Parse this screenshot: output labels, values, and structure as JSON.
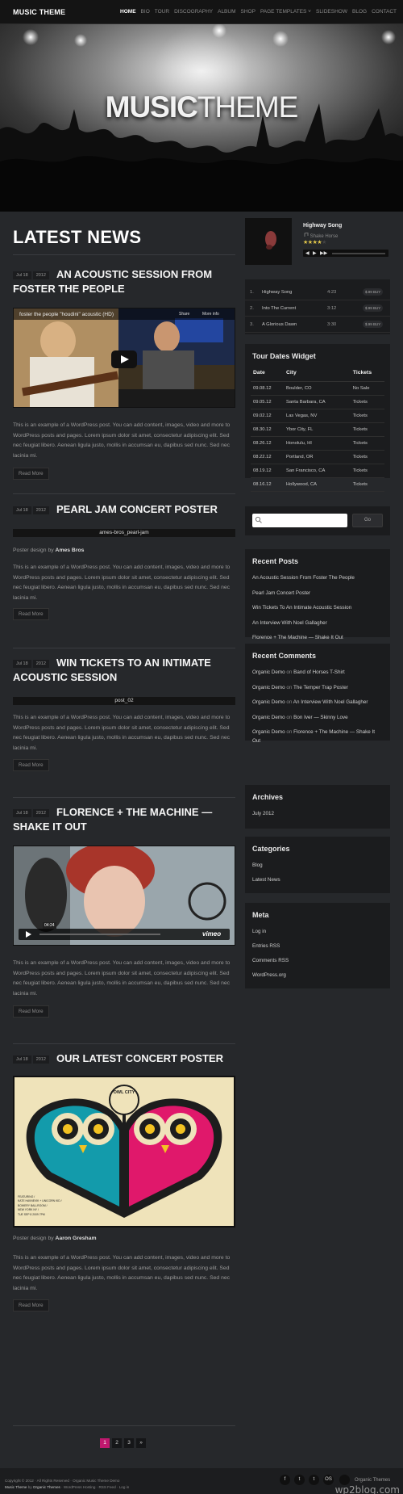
{
  "header": {
    "logo": "MUSIC THEME",
    "nav": [
      "HOME",
      "BIO",
      "TOUR",
      "DISCOGRAPHY",
      "ALBUM",
      "SHOP",
      "PAGE TEMPLATES ˅",
      "SLIDESHOW",
      "BLOG",
      "CONTACT"
    ],
    "active": "HOME"
  },
  "hero": {
    "title_bold": "MUSIC",
    "title_light": "THEME"
  },
  "main": {
    "heading": "LATEST NEWS",
    "read_more": "Read More",
    "excerpt": "This is an example of a WordPress post. You can add content, images, video and more to WordPress posts and pages. Lorem ipsum dolor sit amet, consectetur adipiscing elit. Sed nec feugiat libero. Aenean ligula justo, mollis in accumsan eu, dapibus sed nunc. Sed nec lacinia mi.",
    "posts": [
      {
        "month": "Jul 18",
        "year": "2012",
        "title": "AN ACOUSTIC SESSION FROM FOSTER THE PEOPLE",
        "video_title": "foster the people \"houdini\" acoustic (HD)",
        "share": "Share",
        "more_info": "More info"
      },
      {
        "month": "Jul 18",
        "year": "2012",
        "title": "PEARL JAM CONCERT POSTER",
        "caption": "ames-bros_pearl-jam",
        "poster_by_label": "Poster design by",
        "poster_by": "Ames Bros"
      },
      {
        "month": "Jul 18",
        "year": "2012",
        "title": "WIN TICKETS TO AN INTIMATE ACOUSTIC SESSION",
        "caption": "post_02"
      },
      {
        "month": "Jul 18",
        "year": "2012",
        "title": "FLORENCE + THE MACHINE — SHAKE IT OUT",
        "video_time": "04:24",
        "video_brand": "vimeo"
      },
      {
        "month": "Jul 18",
        "year": "2012",
        "title": "OUR LATEST CONCERT POSTER",
        "poster_text": "OWL CITY",
        "poster_lines": [
          "FEATURING /",
          "KATE HAVNEVIK + UNICORN KID /",
          "BOWERY BALLROOM /",
          "NEW YORK NY /",
          "TUE SEP 8 2009 7PM"
        ],
        "poster_by_label": "Poster design by",
        "poster_by": "Aaron Gresham"
      }
    ],
    "pagination": [
      "1",
      "2",
      "3",
      "»"
    ],
    "current_page": "1"
  },
  "sidebar": {
    "player": {
      "title": "Highway Song",
      "artist": "Shake Horse",
      "rating": 4
    },
    "tracks": [
      {
        "num": "1.",
        "name": "Highway Song",
        "duration": "4:23",
        "buy": "$.99 BUY"
      },
      {
        "num": "2.",
        "name": "Into The Current",
        "duration": "3:12",
        "buy": "$.99 BUY"
      },
      {
        "num": "3.",
        "name": "A Glorious Dawn",
        "duration": "3:30",
        "buy": "$.99 BUY"
      }
    ],
    "tour": {
      "title": "Tour Dates Widget",
      "headers": [
        "Date",
        "City",
        "Tickets"
      ],
      "rows": [
        [
          "09.08.12",
          "Boulder, CO",
          "No Sale"
        ],
        [
          "09.05.12",
          "Santa Barbara, CA",
          "Tickets"
        ],
        [
          "09.02.12",
          "Las Vegas, NV",
          "Tickets"
        ],
        [
          "08.30.12",
          "Ybor City, FL",
          "Tickets"
        ],
        [
          "08.26.12",
          "Honolulu, HI",
          "Tickets"
        ],
        [
          "08.22.12",
          "Portland, OR",
          "Tickets"
        ],
        [
          "08.19.12",
          "San Francisco, CA",
          "Tickets"
        ],
        [
          "08.16.12",
          "Hollywood, CA",
          "Tickets"
        ]
      ]
    },
    "search": {
      "placeholder": "",
      "button": "Go"
    },
    "recent_posts": {
      "title": "Recent Posts",
      "items": [
        "An Acoustic Session From Foster The People",
        "Pearl Jam Concert Poster",
        "Win Tickets To An Intimate Acoustic Session",
        "An Interview With Noel Gallagher",
        "Florence + The Machine — Shake It Out"
      ]
    },
    "recent_comments": {
      "title": "Recent Comments",
      "on": "on",
      "items": [
        {
          "author": "Organic Demo",
          "post": "Band of Horses T-Shirt"
        },
        {
          "author": "Organic Demo",
          "post": "The Temper Trap Poster"
        },
        {
          "author": "Organic Demo",
          "post": "An Interview With Noel Gallagher"
        },
        {
          "author": "Organic Demo",
          "post": "Bon Iver — Skinny Love"
        },
        {
          "author": "Organic Demo",
          "post": "Florence + The Machine — Shake It"
        },
        {
          "author": "",
          "post": "Out"
        }
      ]
    },
    "archives": {
      "title": "Archives",
      "items": [
        "July 2012"
      ]
    },
    "categories": {
      "title": "Categories",
      "items": [
        "Blog",
        "Latest News"
      ]
    },
    "meta": {
      "title": "Meta",
      "items": [
        "Log in",
        "Entries RSS",
        "Comments RSS",
        "WordPress.org"
      ]
    }
  },
  "footer": {
    "copyright": "Copyright © 2012 · All Rights Reserved · Organic Music Theme Demo",
    "theme": "Music Theme",
    "by": "by",
    "organic": "Organic Themes",
    "links": "· WordPress Hosting · RSS Feed · Log in",
    "social": [
      "f",
      "t",
      "t",
      "OS"
    ],
    "brand": "Organic Themes",
    "watermark": "wp2blog.com"
  },
  "colors": {
    "accent": "#c0186e",
    "background": "#26282b",
    "widget": "#1b1c1e"
  }
}
